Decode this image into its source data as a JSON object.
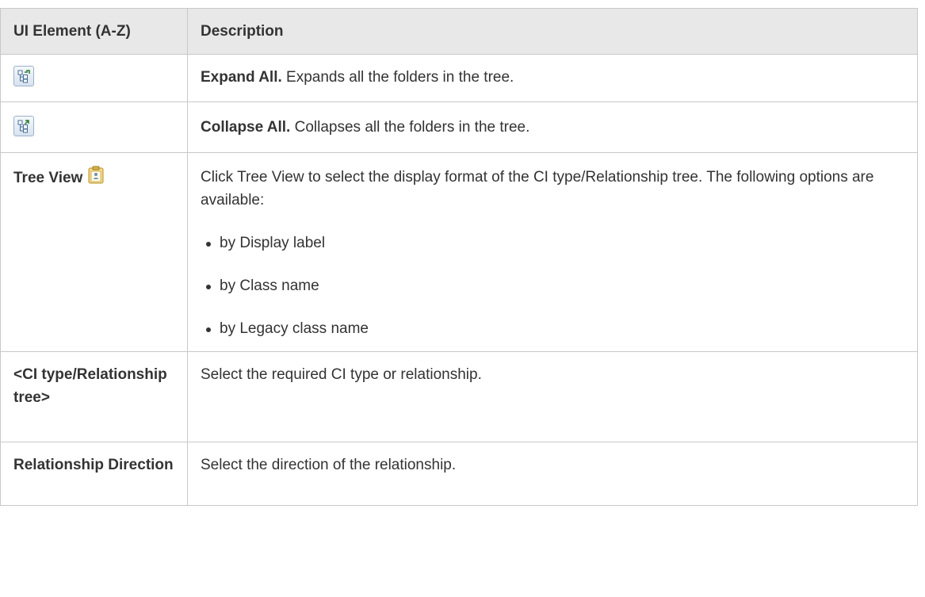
{
  "table": {
    "headers": {
      "element": "UI Element (A-Z)",
      "description": "Description"
    },
    "rows": {
      "expand": {
        "icon": "expand-all-icon",
        "title": "Expand All.",
        "text": " Expands all the folders in the tree."
      },
      "collapse": {
        "icon": "collapse-all-icon",
        "title": "Collapse All.",
        "text": " Collapses all the folders in the tree."
      },
      "tree_view": {
        "label": "Tree View",
        "icon": "tree-view-icon",
        "text": "Click Tree View to select the display format of the CI type/Relationship tree. The following options are available:",
        "options": [
          "by Display label",
          "by Class name",
          "by Legacy class name"
        ]
      },
      "ci_tree": {
        "label": "<CI type/Relationship tree>",
        "text": "Select the required CI type or relationship."
      },
      "relationship_direction": {
        "label": "Relationship Direction",
        "text": "Select the direction of the relationship."
      }
    }
  }
}
